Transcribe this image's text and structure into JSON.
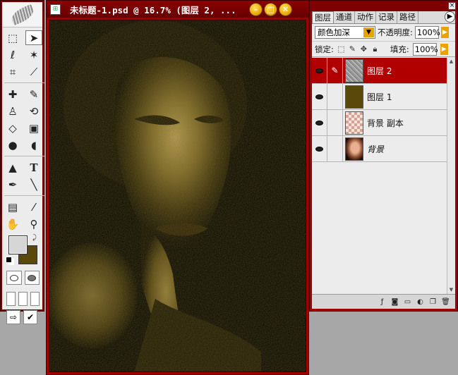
{
  "colors": {
    "window_border": "#a00000",
    "selected_layer": "#b10000",
    "foreground_swatch": "#d5d5d5",
    "background_swatch": "#5a470a",
    "sepia_tint": "#5a470a"
  },
  "toolbox": {
    "tools": [
      "marquee-icon",
      "move-icon",
      "lasso-icon",
      "magic-wand-icon",
      "crop-icon",
      "slice-icon",
      "healing-brush-icon",
      "brush-icon",
      "clone-stamp-icon",
      "history-brush-icon",
      "eraser-icon",
      "gradient-icon",
      "blur-icon",
      "dodge-icon",
      "path-select-icon",
      "type-icon",
      "pen-icon",
      "line-icon",
      "notes-icon",
      "eyedropper-icon",
      "hand-icon",
      "zoom-icon"
    ],
    "selected_tool": "move-icon"
  },
  "document": {
    "title": "未标题-1.psd @ 16.7% (图层 2, ...",
    "zoom": "16.7%",
    "active_layer": "图层 2"
  },
  "layers_panel": {
    "tabs": [
      "图层",
      "通道",
      "动作",
      "记录",
      "路径"
    ],
    "active_tab": "图层",
    "blend_mode": "颜色加深",
    "opacity_label": "不透明度:",
    "opacity_value": "100%",
    "lock_label": "锁定:",
    "fill_label": "填充:",
    "fill_value": "100%",
    "layers": [
      {
        "name": "图层 2",
        "selected": true,
        "visible": true,
        "linked": false,
        "thumb": "noise",
        "locked": false,
        "italic": false
      },
      {
        "name": "图层 1",
        "selected": false,
        "visible": true,
        "linked": false,
        "thumb": "olive",
        "locked": false,
        "italic": false
      },
      {
        "name": "背景 副本",
        "selected": false,
        "visible": true,
        "linked": false,
        "thumb": "transparent",
        "locked": false,
        "italic": false
      },
      {
        "name": "背景",
        "selected": false,
        "visible": true,
        "linked": false,
        "thumb": "photo",
        "locked": true,
        "italic": true
      }
    ],
    "bottom_icons": [
      "add-style-icon",
      "add-mask-icon",
      "new-group-icon",
      "adjustment-layer-icon",
      "new-layer-icon",
      "delete-layer-icon"
    ]
  }
}
